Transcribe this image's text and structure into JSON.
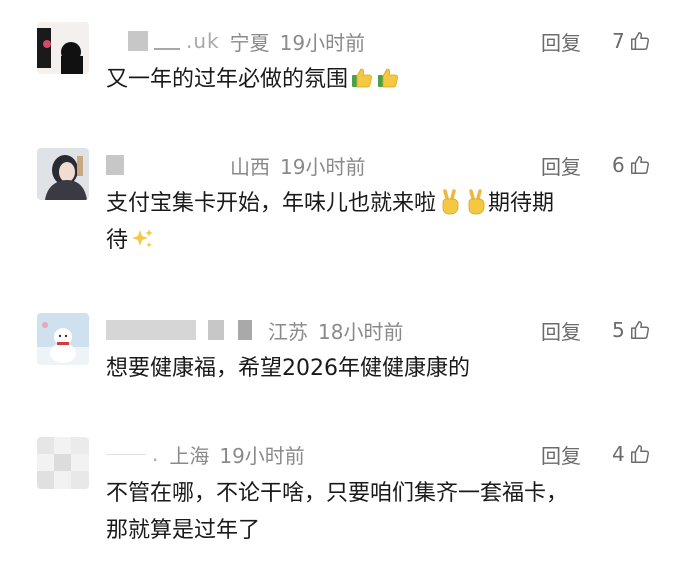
{
  "comments": [
    {
      "name_visible": ".uk",
      "location": "宁夏",
      "time": "19小时前",
      "reply_label": "回复",
      "likes": "7",
      "text": "又一年的过年必做的氛围",
      "emoji_tail": [
        "thumbs-up",
        "thumbs-up"
      ]
    },
    {
      "name_visible": "",
      "location": "山西",
      "time": "19小时前",
      "reply_label": "回复",
      "likes": "6",
      "text_part1": "支付宝集卡开始，年味儿也就来啦",
      "text_part2": "期待期",
      "text_line2": "待",
      "emoji_tail": [
        "victory-hand",
        "victory-hand",
        "sparkles"
      ]
    },
    {
      "name_visible": "",
      "location": "江苏",
      "time": "18小时前",
      "reply_label": "回复",
      "likes": "5",
      "text": "想要健康福，希望2026年健健康康的"
    },
    {
      "name_visible": ".",
      "location": "上海",
      "time": "19小时前",
      "reply_label": "回复",
      "likes": "4",
      "text_line1": "不管在哪，不论干啥，只要咱们集齐一套福卡，",
      "text_line2": "那就算是过年了"
    }
  ],
  "colors": {
    "meta": "#8a8a8a",
    "body_text": "#1a1a1a",
    "action": "#6b6b6b"
  }
}
